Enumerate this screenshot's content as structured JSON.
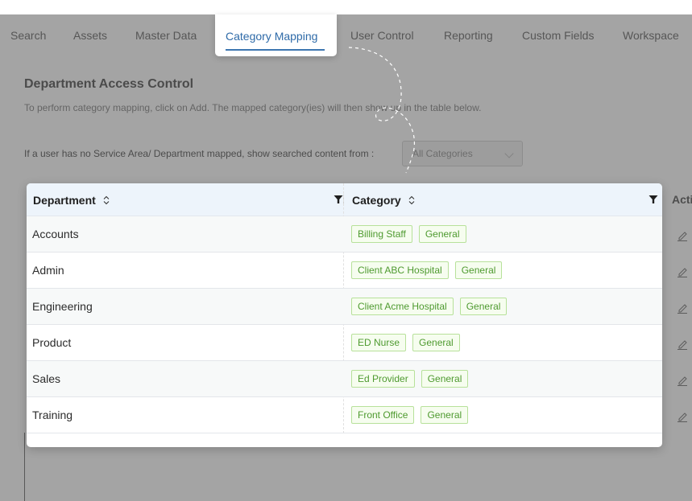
{
  "nav": {
    "tabs": [
      {
        "label": "Search"
      },
      {
        "label": "Assets"
      },
      {
        "label": "Master Data"
      },
      {
        "label": "Category Mapping",
        "active": true
      },
      {
        "label": "User Control"
      },
      {
        "label": "Reporting"
      },
      {
        "label": "Custom Fields"
      },
      {
        "label": "Workspace"
      }
    ],
    "active_color": "#2e6aa8"
  },
  "section": {
    "title": "Department Access Control",
    "description": "To perform category mapping, click on Add. The mapped category(ies) will then show up in the table below.",
    "fallback_label": "If a user has no Service Area/ Department mapped, show searched content from :",
    "fallback_select": {
      "value": "All Categories"
    }
  },
  "table": {
    "columns": [
      {
        "label": "Department",
        "sortable": true,
        "filterable": true
      },
      {
        "label": "Category",
        "sortable": true,
        "filterable": true
      },
      {
        "label": "Acti"
      }
    ],
    "rows": [
      {
        "department": "Accounts",
        "categories": [
          "Billing Staff",
          "General"
        ]
      },
      {
        "department": "Admin",
        "categories": [
          "Client ABC Hospital",
          "General"
        ]
      },
      {
        "department": "Engineering",
        "categories": [
          "Client Acme Hospital",
          "General"
        ]
      },
      {
        "department": "Product",
        "categories": [
          "ED Nurse",
          "General"
        ]
      },
      {
        "department": "Sales",
        "categories": [
          "Ed Provider",
          "General"
        ]
      },
      {
        "department": "Training",
        "categories": [
          "Front Office",
          "General"
        ]
      }
    ],
    "tag_color": "#4e9a2f"
  },
  "icons": {
    "sort": "sort-icon",
    "filter": "filter-icon",
    "edit": "pencil-icon",
    "dropdown": "chevron-down-icon"
  }
}
